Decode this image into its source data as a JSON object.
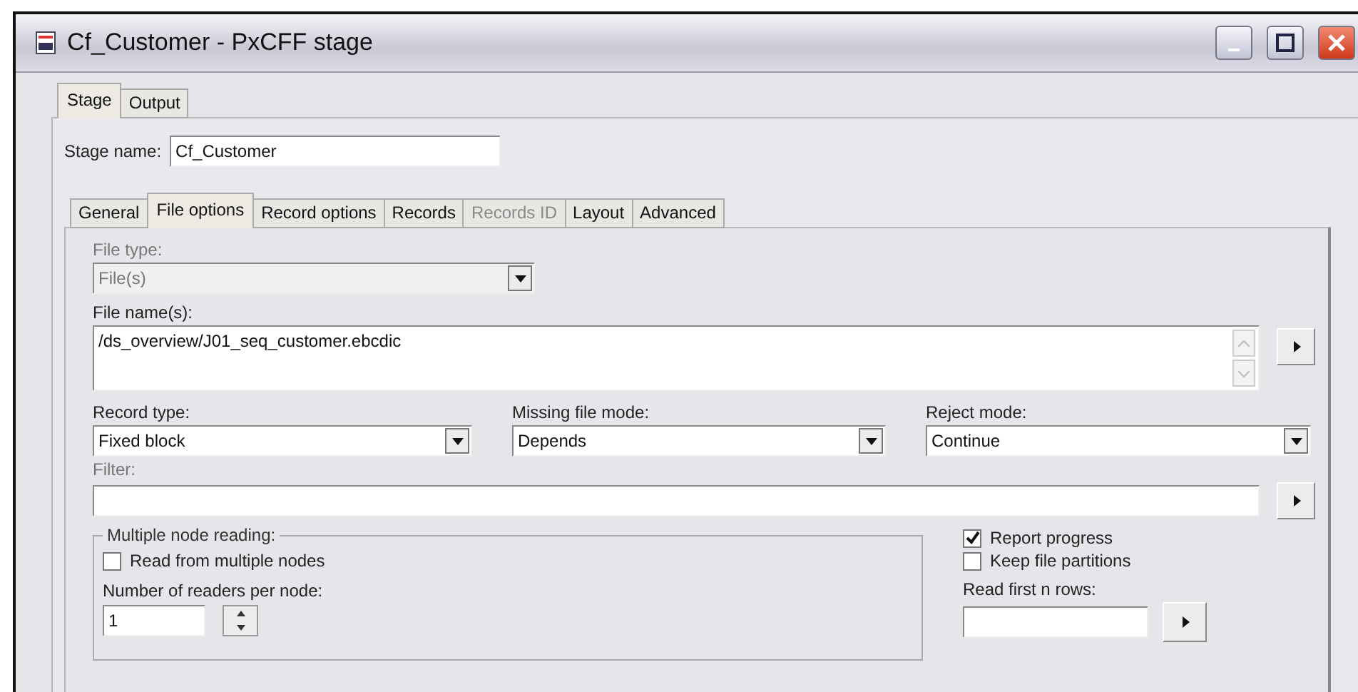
{
  "window": {
    "title": "Cf_Customer - PxCFF stage"
  },
  "outer_tabs": [
    {
      "label": "Stage",
      "selected": true
    },
    {
      "label": "Output",
      "selected": false
    }
  ],
  "stage_name": {
    "label": "Stage name:",
    "value": "Cf_Customer"
  },
  "inner_tabs": [
    {
      "label": "General",
      "selected": false,
      "disabled": false
    },
    {
      "label": "File options",
      "selected": true,
      "disabled": false
    },
    {
      "label": "Record options",
      "selected": false,
      "disabled": false
    },
    {
      "label": "Records",
      "selected": false,
      "disabled": false
    },
    {
      "label": "Records ID",
      "selected": false,
      "disabled": true
    },
    {
      "label": "Layout",
      "selected": false,
      "disabled": false
    },
    {
      "label": "Advanced",
      "selected": false,
      "disabled": false
    }
  ],
  "file_type": {
    "label": "File type:",
    "value": "File(s)",
    "disabled": true
  },
  "file_names": {
    "label": "File name(s):",
    "value": "/ds_overview/J01_seq_customer.ebcdic"
  },
  "dropdowns": [
    {
      "label": "Record type:",
      "value": "Fixed block"
    },
    {
      "label": "Missing file mode:",
      "value": "Depends"
    },
    {
      "label": "Reject mode:",
      "value": "Continue"
    }
  ],
  "filter": {
    "label": "Filter:"
  },
  "multiple_node_reading": {
    "title": "Multiple node reading:",
    "checkbox": {
      "label": "Read from multiple nodes",
      "checked": false
    },
    "readers_label": "Number of readers per node:",
    "readers_value": "1"
  },
  "options": [
    {
      "label": "Report progress",
      "checked": true
    },
    {
      "label": "Keep file partitions",
      "checked": false
    }
  ],
  "read_first_rows": {
    "label": "Read first n rows:"
  }
}
